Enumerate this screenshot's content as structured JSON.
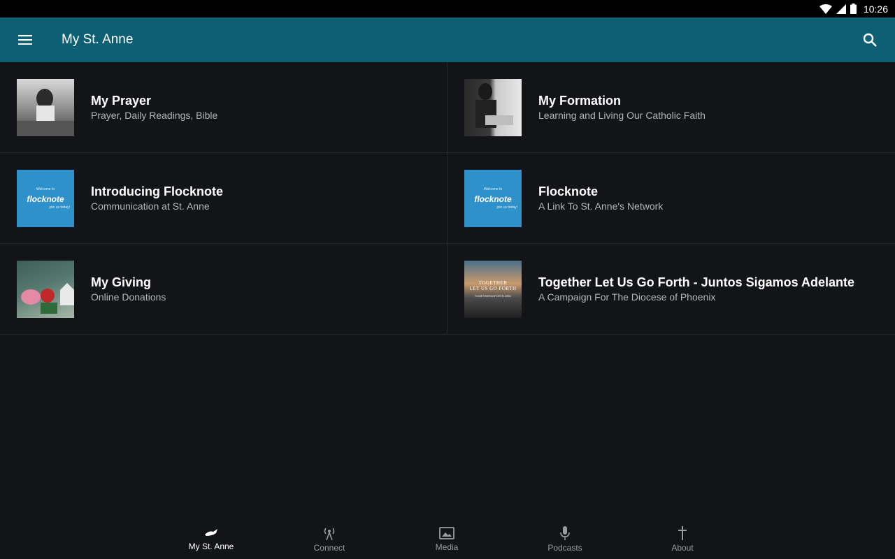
{
  "status_bar": {
    "time": "10:26"
  },
  "app_bar": {
    "title": "My St. Anne"
  },
  "tiles": [
    {
      "title": "My Prayer",
      "subtitle": "Prayer, Daily Readings, Bible"
    },
    {
      "title": "My Formation",
      "subtitle": "Learning and Living Our Catholic Faith"
    },
    {
      "title": "Introducing Flocknote",
      "subtitle": "Communication at St. Anne"
    },
    {
      "title": "Flocknote",
      "subtitle": "A Link To St. Anne's Network"
    },
    {
      "title": "My Giving",
      "subtitle": "Online Donations"
    },
    {
      "title": "Together Let Us Go Forth - Juntos Sigamos Adelante",
      "subtitle": "A Campaign For The Diocese of Phoenix"
    }
  ],
  "thumb_text": {
    "flock_welcome": "Welcome to",
    "flock_logo": "flocknote",
    "flock_join": "join us today!",
    "together_logo": "TOGETHER",
    "together_line2": "LET US GO FORTH",
    "together_url": "TOGETHERGOFORTH.ORG"
  },
  "bottom_nav": [
    {
      "label": "My St. Anne",
      "icon": "hands-icon",
      "active": true
    },
    {
      "label": "Connect",
      "icon": "antenna-icon",
      "active": false
    },
    {
      "label": "Media",
      "icon": "image-icon",
      "active": false
    },
    {
      "label": "Podcasts",
      "icon": "microphone-icon",
      "active": false
    },
    {
      "label": "About",
      "icon": "cross-icon",
      "active": false
    }
  ],
  "colors": {
    "app_bar": "#0e5f73",
    "background": "#131417",
    "subtitle": "#b4b6ba"
  }
}
